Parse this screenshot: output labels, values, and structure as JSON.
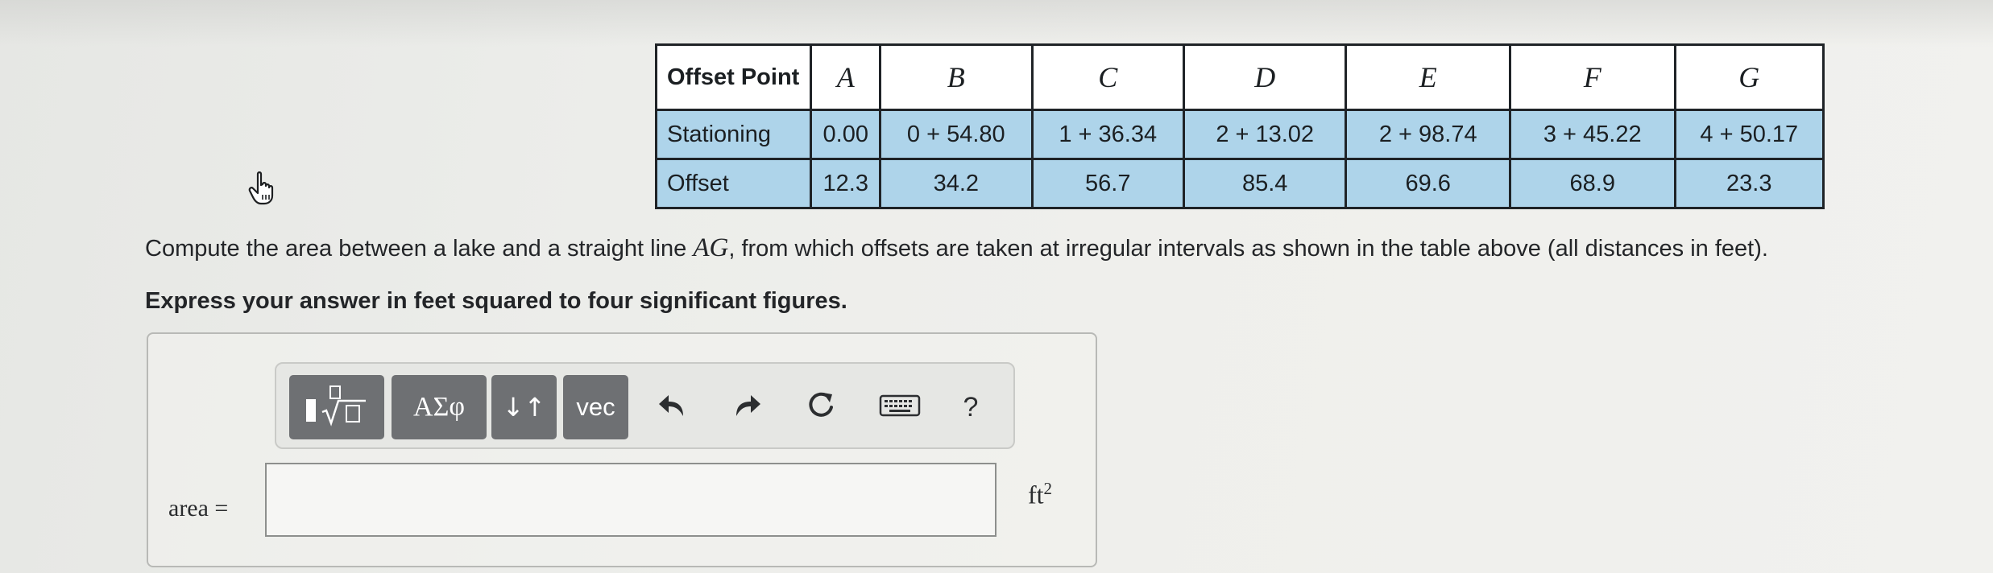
{
  "table": {
    "headers": [
      "Offset Point",
      "A",
      "B",
      "C",
      "D",
      "E",
      "F",
      "G"
    ],
    "rows": [
      {
        "label": "Stationing",
        "values": [
          "0.00",
          "0 + 54.80",
          "1 + 36.34",
          "2 + 13.02",
          "2 + 98.74",
          "3 + 45.22",
          "4 + 50.17"
        ]
      },
      {
        "label": "Offset",
        "values": [
          "12.3",
          "34.2",
          "56.7",
          "85.4",
          "69.6",
          "68.9",
          "23.3"
        ]
      }
    ]
  },
  "question": {
    "before": "Compute the area between a lake and a straight line ",
    "math": "AG",
    "after": ", from which offsets are taken at irregular intervals as shown in the table above (all distances in feet).",
    "instruction": "Express your answer in feet squared to four significant figures."
  },
  "toolbar": {
    "greek_label": "ΑΣφ",
    "arrows_label": "↓↑",
    "vec_label": "vec",
    "help_label": "?"
  },
  "answer": {
    "label": "area =",
    "value": "",
    "placeholder": "",
    "unit_base": "ft",
    "unit_exp": "2"
  },
  "icons": {
    "cursor": "hand-pointer-icon",
    "templates": "fraction-sqrt-template-icon",
    "undo": "undo-icon",
    "redo": "redo-icon",
    "reset": "reset-icon",
    "keyboard": "keyboard-icon"
  }
}
